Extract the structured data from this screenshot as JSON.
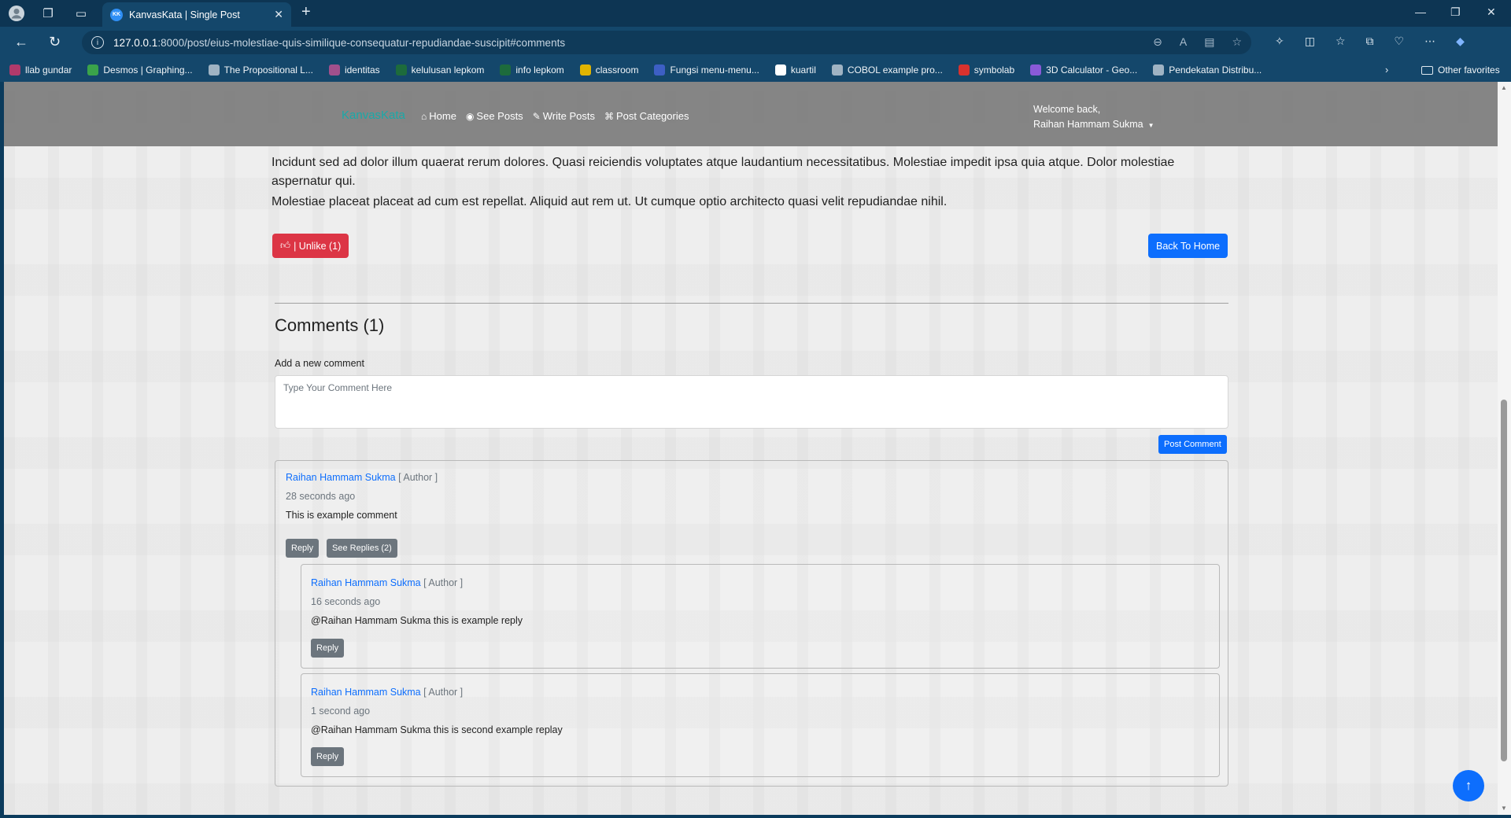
{
  "browser": {
    "tab_title": "KanvasKata | Single Post",
    "tab_favicon": "KK",
    "url_host": "127.0.0.1",
    "url_rest": ":8000/post/eius-molestiae-quis-similique-consequatur-repudiandae-suscipit#comments",
    "bookmarks": [
      {
        "label": "llab gundar",
        "color": "#b03a6b"
      },
      {
        "label": "Desmos | Graphing...",
        "color": "#3aa34a"
      },
      {
        "label": "The Propositional L...",
        "color": "#9fb3c3"
      },
      {
        "label": "identitas",
        "color": "#a2508c"
      },
      {
        "label": "kelulusan lepkom",
        "color": "#1d6b3c"
      },
      {
        "label": "info lepkom",
        "color": "#1d6b3c"
      },
      {
        "label": "classroom",
        "color": "#e0b400"
      },
      {
        "label": "Fungsi menu-menu...",
        "color": "#3d5fc4"
      },
      {
        "label": "kuartil",
        "color": "#ffffff"
      },
      {
        "label": "COBOL example pro...",
        "color": "#9fb3c3"
      },
      {
        "label": "symbolab",
        "color": "#d9322e"
      },
      {
        "label": "3D Calculator - Geo...",
        "color": "#8a5ad8"
      },
      {
        "label": "Pendekatan Distribu...",
        "color": "#9fb3c3"
      }
    ],
    "other_favorites": "Other favorites"
  },
  "site": {
    "brand": "KanvasKata",
    "nav": [
      "Home",
      "See Posts",
      "Write Posts",
      "Post Categories"
    ],
    "welcome_line": "Welcome back,",
    "user_name": "Raihan Hammam Sukma"
  },
  "post": {
    "paragraph1": "Incidunt sed ad dolor illum quaerat rerum dolores. Quasi reiciendis voluptates atque laudantium necessitatibus. Molestiae impedit ipsa quia atque. Dolor molestiae aspernatur qui.",
    "paragraph2": "Molestiae placeat placeat ad cum est repellat. Aliquid aut rem ut. Ut cumque optio architecto quasi velit repudiandae nihil.",
    "unlike_label": "| Unlike (1)",
    "back_label": "Back To Home"
  },
  "comments": {
    "title": "Comments (1)",
    "add_label": "Add a new comment",
    "placeholder": "Type Your Comment Here",
    "post_label": "Post Comment",
    "items": [
      {
        "author": "Raihan Hammam Sukma",
        "role": "[ Author ]",
        "time": "28 seconds ago",
        "body": "This is example comment",
        "reply_label": "Reply",
        "see_replies_label": "See Replies (2)"
      }
    ],
    "replies": [
      {
        "author": "Raihan Hammam Sukma",
        "role": "[ Author ]",
        "time": "16 seconds ago",
        "body": "@Raihan Hammam Sukma this is example reply",
        "reply_label": "Reply"
      },
      {
        "author": "Raihan Hammam Sukma",
        "role": "[ Author ]",
        "time": "1 second ago",
        "body": "@Raihan Hammam Sukma this is second example replay",
        "reply_label": "Reply"
      }
    ]
  }
}
